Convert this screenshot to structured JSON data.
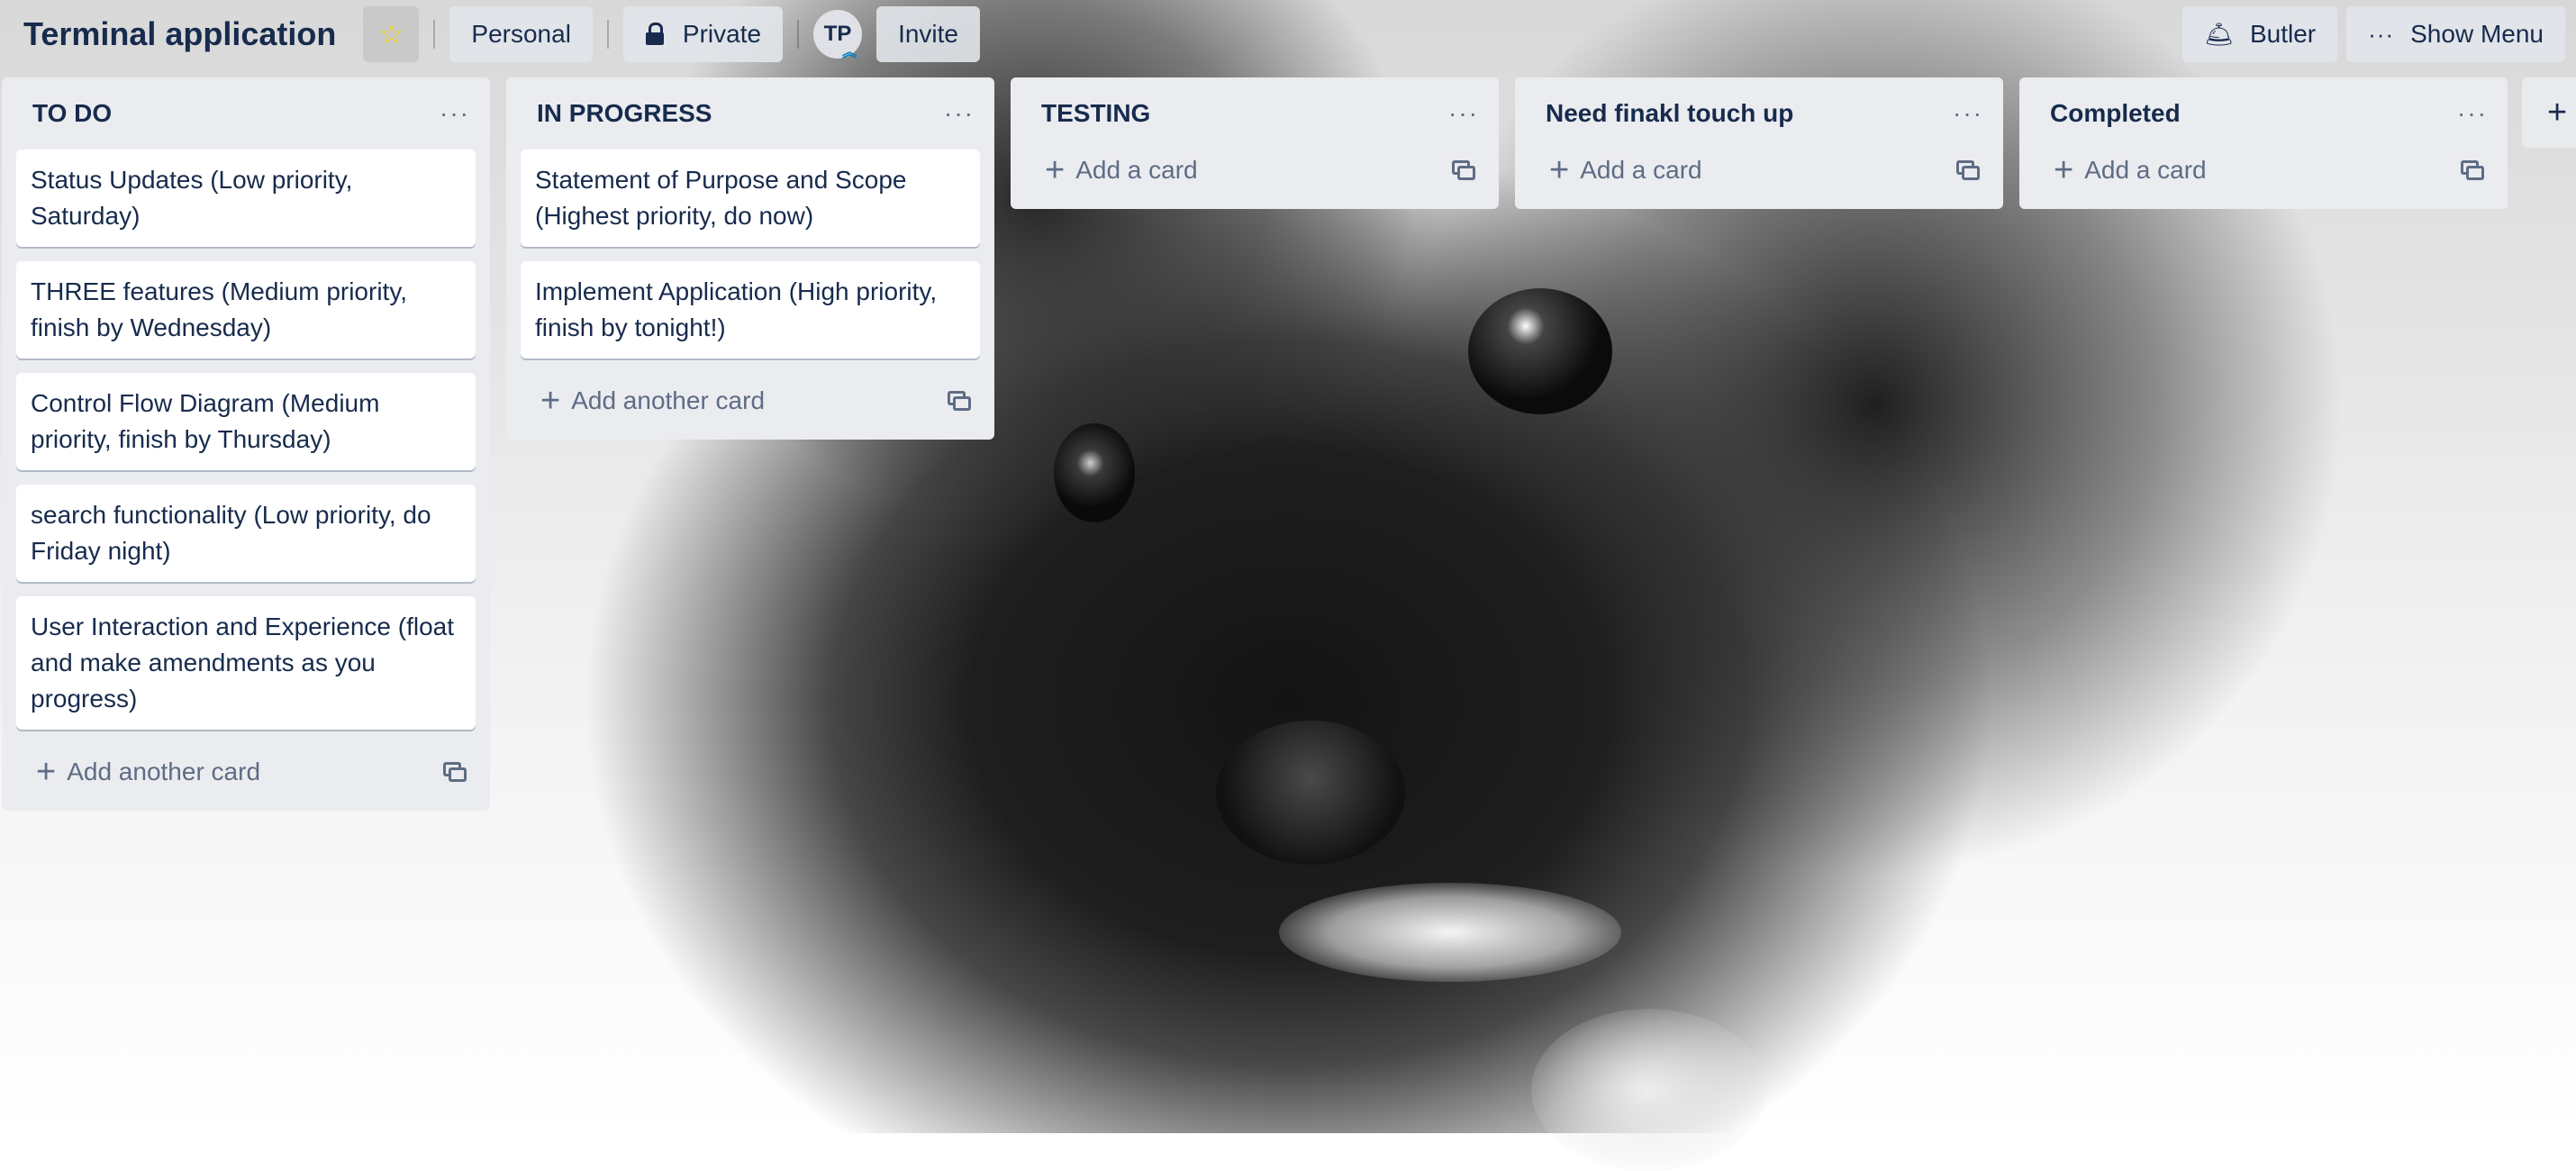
{
  "header": {
    "board_title": "Terminal application",
    "visibility_team": "Personal",
    "visibility_privacy": "Private",
    "member_initials": "TP",
    "invite_label": "Invite",
    "butler_label": "Butler",
    "show_menu_label": "Show Menu"
  },
  "lists": [
    {
      "title": "TO DO",
      "cards": [
        "Status Updates (Low priority, Saturday)",
        "THREE features (Medium priority, finish by Wednesday)",
        "Control Flow Diagram (Medium priority, finish by Thursday)",
        "search functionality (Low priority, do Friday night)",
        "User Interaction and Experience (float and make amendments as you progress)"
      ],
      "add_label": "Add another card"
    },
    {
      "title": "IN PROGRESS",
      "cards": [
        "Statement of Purpose and Scope (Highest priority, do now)",
        "Implement Application (High priority, finish by tonight!)"
      ],
      "add_label": "Add another card"
    },
    {
      "title": "TESTING",
      "cards": [],
      "add_label": "Add a card"
    },
    {
      "title": "Need finakl touch up",
      "cards": [],
      "add_label": "Add a card"
    },
    {
      "title": "Completed",
      "cards": [],
      "add_label": "Add a card"
    }
  ],
  "icons": {
    "star": "star-icon",
    "lock": "lock-icon",
    "butler": "butler-icon",
    "menu": "more-horizontal-icon",
    "plus": "plus-icon",
    "template": "card-template-icon"
  },
  "colors": {
    "list_bg": "#ebecf0",
    "text": "#172b4d",
    "muted": "#5e6c84",
    "star": "#f2d600"
  }
}
